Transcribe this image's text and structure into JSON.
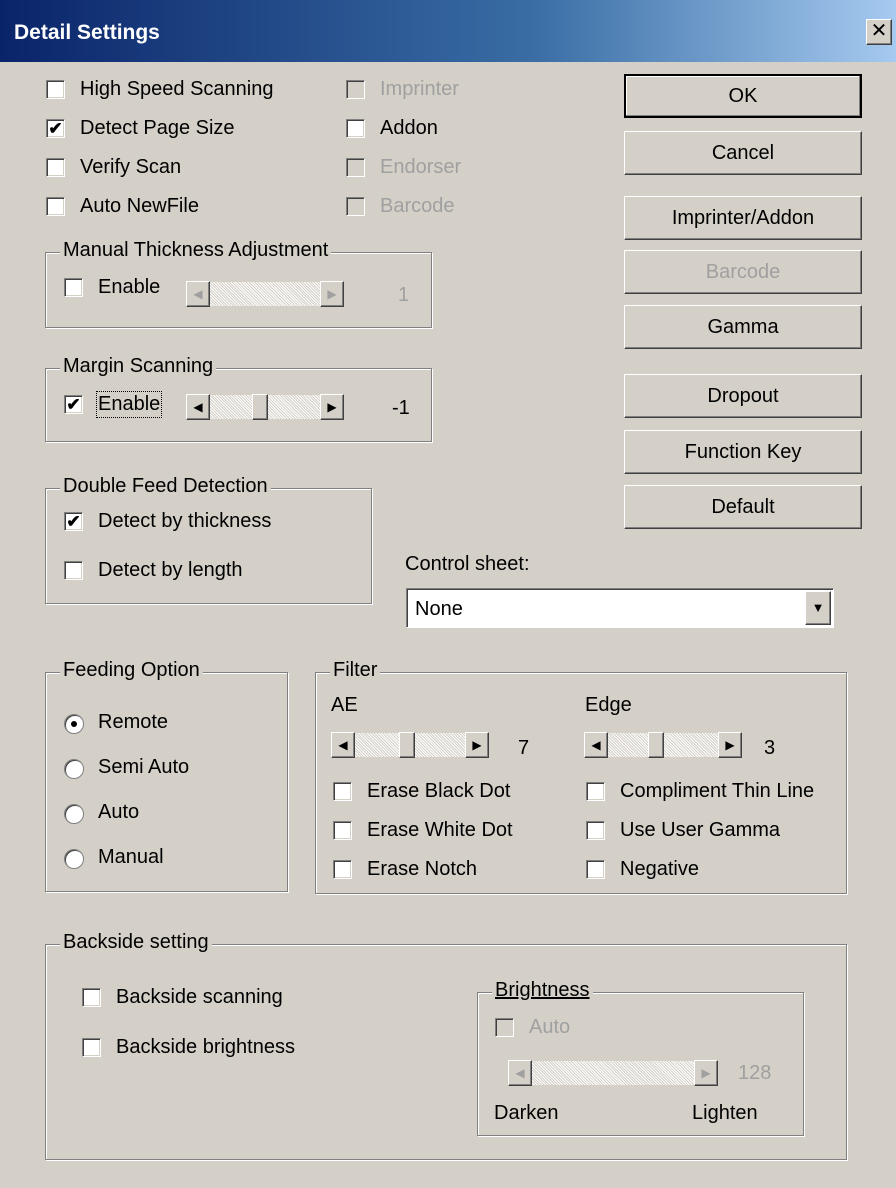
{
  "window": {
    "title": "Detail Settings",
    "close_glyph": "✕"
  },
  "options": {
    "high_speed": {
      "label": "High Speed Scanning",
      "checked": false
    },
    "detect_page_size": {
      "label": "Detect Page Size",
      "checked": true
    },
    "verify_scan": {
      "label": "Verify Scan",
      "checked": false
    },
    "auto_newfile": {
      "label": "Auto NewFile",
      "checked": false
    },
    "imprinter": {
      "label": "Imprinter",
      "checked": false,
      "enabled": false
    },
    "addon": {
      "label": "Addon",
      "checked": false,
      "enabled": true
    },
    "endorser": {
      "label": "Endorser",
      "checked": false,
      "enabled": false
    },
    "barcode": {
      "label": "Barcode",
      "checked": false,
      "enabled": false
    }
  },
  "buttons": {
    "ok": "OK",
    "cancel": "Cancel",
    "imprinter_addon": "Imprinter/Addon",
    "barcode": "Barcode",
    "gamma": "Gamma",
    "dropout": "Dropout",
    "function_key": "Function Key",
    "default": "Default"
  },
  "manual_thickness": {
    "title": "Manual Thickness Adjustment",
    "enable_label": "Enable",
    "checked": false,
    "value": "1"
  },
  "margin_scanning": {
    "title": "Margin Scanning",
    "enable_label": "Enable",
    "checked": true,
    "value": "-1"
  },
  "double_feed": {
    "title": "Double Feed Detection",
    "thickness": {
      "label": "Detect by thickness",
      "checked": true
    },
    "length": {
      "label": "Detect by length",
      "checked": false
    }
  },
  "control_sheet": {
    "label": "Control sheet:",
    "value": "None"
  },
  "feeding_option": {
    "title": "Feeding Option",
    "remote": "Remote",
    "semi_auto": "Semi Auto",
    "auto": "Auto",
    "manual": "Manual",
    "selected": "Remote"
  },
  "filter": {
    "title": "Filter",
    "ae_label": "AE",
    "ae_value": "7",
    "edge_label": "Edge",
    "edge_value": "3",
    "erase_black_dot": {
      "label": "Erase Black Dot",
      "checked": false
    },
    "erase_white_dot": {
      "label": "Erase White Dot",
      "checked": false
    },
    "erase_notch": {
      "label": "Erase Notch",
      "checked": false
    },
    "compliment_thin_line": {
      "label": "Compliment Thin Line",
      "checked": false
    },
    "use_user_gamma": {
      "label": "Use User Gamma",
      "checked": false
    },
    "negative": {
      "label": "Negative",
      "checked": false
    }
  },
  "backside": {
    "title": "Backside setting",
    "scanning": {
      "label": "Backside scanning",
      "checked": false
    },
    "brightness_check": {
      "label": "Backside brightness",
      "checked": false
    },
    "brightness_group": {
      "title": "Brightness",
      "auto_label": "Auto",
      "value": "128",
      "darken_label": "Darken",
      "lighten_label": "Lighten"
    }
  },
  "glyphs": {
    "check": "✔",
    "arrow_left": "◀",
    "arrow_right": "▶",
    "arrow_down": "▼"
  },
  "icons": [
    "close-icon",
    "checkmark-icon",
    "left-arrow-icon",
    "right-arrow-icon",
    "dropdown-arrow-icon"
  ]
}
